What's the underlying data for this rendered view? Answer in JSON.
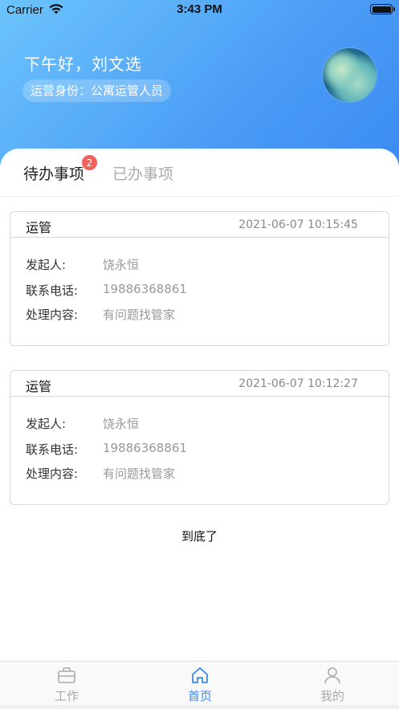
{
  "status_bar": {
    "carrier": "Carrier",
    "time": "3:43 PM"
  },
  "header": {
    "greeting": "下午好，刘文选",
    "role": "运营身份：公寓运管人员"
  },
  "tabs": {
    "pending": "待办事项",
    "pending_count": "2",
    "done": "已办事项"
  },
  "tasks": [
    {
      "type": "运管",
      "time": "2021-06-07 10:15:45",
      "initiator_label": "发起人:",
      "initiator": "饶永恒",
      "phone_label": "联系电话:",
      "phone": "19886368861",
      "content_label": "处理内容:",
      "content": "有问题找管家"
    },
    {
      "type": "运管",
      "time": "2021-06-07 10:12:27",
      "initiator_label": "发起人:",
      "initiator": "饶永恒",
      "phone_label": "联系电话:",
      "phone": "19886368861",
      "content_label": "处理内容:",
      "content": "有问题找管家"
    }
  ],
  "end_text": "到底了",
  "tabbar": {
    "work": "工作",
    "home": "首页",
    "mine": "我的"
  },
  "colors": {
    "accent": "#3a8af3",
    "badge": "#f1605a",
    "header_start": "#6cc4fb",
    "header_end": "#3a8af3"
  },
  "icons": [
    "wifi-icon",
    "battery-icon",
    "briefcase-icon",
    "home-icon",
    "user-icon"
  ]
}
